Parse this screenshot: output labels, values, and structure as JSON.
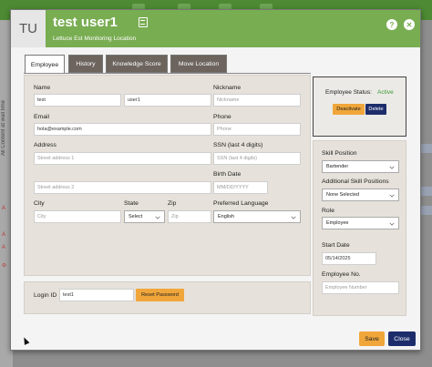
{
  "background": {
    "vertical_text": "All Content at wall time",
    "mark_a": "A",
    "mark_x": "⊘"
  },
  "header": {
    "avatar_initials": "TU",
    "user_name": "test user1",
    "subtitle": "Lettuce Est Monitoring Location",
    "help_glyph": "?",
    "close_glyph": "✕"
  },
  "tabs": [
    {
      "label": "Employee",
      "active": true
    },
    {
      "label": "History",
      "active": false
    },
    {
      "label": "Knowledge Score",
      "active": false
    },
    {
      "label": "Move Location",
      "active": false
    }
  ],
  "form": {
    "name": {
      "label": "Name",
      "first": "test",
      "last": "user1"
    },
    "nickname": {
      "label": "Nickname",
      "placeholder": "Nickname"
    },
    "email": {
      "label": "Email",
      "value": "hola@example.com"
    },
    "phone": {
      "label": "Phone",
      "placeholder": "Phone"
    },
    "address": {
      "label": "Address",
      "line1_placeholder": "Street address 1",
      "line2_placeholder": "Street address 2"
    },
    "ssn": {
      "label": "SSN (last 4 digits)",
      "placeholder": "SSN (last 4 digits)"
    },
    "birth_date": {
      "label": "Birth Date",
      "placeholder": "MM/DD/YYYY"
    },
    "city": {
      "label": "City",
      "placeholder": "City"
    },
    "state": {
      "label": "State",
      "value": "Select"
    },
    "zip": {
      "label": "Zip",
      "placeholder": "Zip"
    },
    "language": {
      "label": "Preferred Language",
      "value": "English"
    }
  },
  "login": {
    "label": "Login ID",
    "value": "test1",
    "reset_label": "Reset Password"
  },
  "status": {
    "label": "Employee Status:",
    "value": "Active",
    "deactivate_label": "Deactivate",
    "delete_label": "Delete"
  },
  "side": {
    "skill_position": {
      "label": "Skill Position",
      "value": "Bartender"
    },
    "additional_skills": {
      "label": "Additional Skill Positions",
      "value": "None Selected"
    },
    "role": {
      "label": "Role",
      "value": "Employee"
    },
    "start_date": {
      "label": "Start Date",
      "value": "05/14/2025"
    },
    "employee_no": {
      "label": "Employee No.",
      "placeholder": "Employee Number"
    }
  },
  "footer": {
    "save_label": "Save",
    "close_label": "Close"
  },
  "colors": {
    "header_green": "#79ad52",
    "status_green": "#3b9a35",
    "orange": "#f0a63a",
    "navy": "#1d2d6b",
    "tab_brown": "#6c645d"
  }
}
